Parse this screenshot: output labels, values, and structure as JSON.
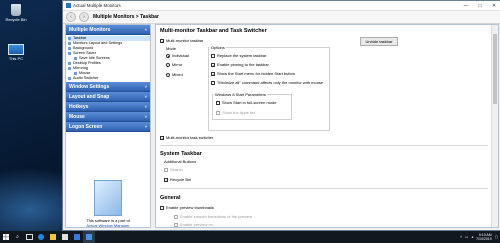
{
  "desktop": {
    "icons": [
      {
        "label": "Recycle Bin"
      },
      {
        "label": "This PC"
      }
    ]
  },
  "window": {
    "title": "Actual Multiple Monitors",
    "minimize": "—",
    "maximize": "□",
    "close": "✕"
  },
  "toolbar": {
    "back": "‹",
    "forward": "›",
    "breadcrumb_root": "Multiple Monitors",
    "breadcrumb_sep": ">",
    "breadcrumb_page": "Taskbar"
  },
  "sidebar": {
    "categories": [
      {
        "label": "Multiple Monitors",
        "chevron": "˄"
      },
      {
        "label": "Window Settings",
        "chevron": "˅"
      },
      {
        "label": "Layout and Snap",
        "chevron": "˅"
      },
      {
        "label": "Hotkeys",
        "chevron": "˅"
      },
      {
        "label": "Mouse",
        "chevron": "˅"
      },
      {
        "label": "Logon Screen",
        "chevron": "˅"
      }
    ],
    "tree": [
      {
        "label": "Taskbar",
        "level": 1,
        "selected": true
      },
      {
        "label": "Monitors Layout and Settings",
        "level": 1
      },
      {
        "label": "Background",
        "level": 1
      },
      {
        "label": "Screen Saver",
        "level": 1
      },
      {
        "label": "Save Idle Screens",
        "level": 2
      },
      {
        "label": "Desktop Profiles",
        "level": 1
      },
      {
        "label": "Mirroring",
        "level": 1
      },
      {
        "label": "Mouse",
        "level": 2
      },
      {
        "label": "Audio Switcher",
        "level": 1
      }
    ],
    "promo_text": "This software is a part of",
    "promo_link": "Actual Window Manager"
  },
  "content": {
    "section1_title": "Multi-monitor Taskbar and Task Switcher",
    "multi_monitor_taskbar": {
      "label": "Multi-monitor taskbar",
      "checked": true
    },
    "unhide_button": "Unhide taskbar",
    "mode": {
      "label": "Mode",
      "options": [
        {
          "label": "Individual",
          "selected": true
        },
        {
          "label": "Mirror",
          "selected": false
        },
        {
          "label": "Mixed",
          "selected": false
        }
      ]
    },
    "options": {
      "label": "Options",
      "items": [
        {
          "label": "Replace the system taskbar",
          "checked": false
        },
        {
          "label": "Enable pinning to the taskbar",
          "checked": true
        },
        {
          "label": "Show the Start menu for hidden Start button",
          "checked": true
        },
        {
          "label": "\"Minimize all\" command affects only the monitor with mouse",
          "checked": false
        }
      ]
    },
    "win8": {
      "label": "Windows 8 Start Parameters",
      "items": [
        {
          "label": "Show Start in full-screen mode",
          "checked": false,
          "disabled": false
        },
        {
          "label": "Show the Apps list",
          "checked": false,
          "disabled": true
        }
      ]
    },
    "task_switcher": {
      "label": "Multi-monitor task switcher",
      "checked": true
    },
    "section2_title": "System Taskbar",
    "additional_buttons": {
      "label": "Additional Buttons",
      "items": [
        {
          "label": "Search",
          "checked": false,
          "disabled": true
        },
        {
          "label": "Recycle Bin",
          "checked": true,
          "disabled": false
        }
      ]
    },
    "section3_title": "General",
    "general": [
      {
        "label": "Enable preview thumbnails",
        "checked": false,
        "disabled": false
      },
      {
        "label": "Enable smooth transitions of the preview",
        "checked": false,
        "disabled": true
      },
      {
        "label": "Enable preview on...",
        "checked": false,
        "disabled": true
      }
    ]
  },
  "taskbar": {
    "start_icon": "start-icon",
    "search_icon": "search-icon",
    "tray_time": "9:10 AM",
    "tray_date": "7/10/2019"
  },
  "colors": {
    "accent": "#2f61b1",
    "selection": "#cde3fb",
    "taskbar": "#101820"
  }
}
